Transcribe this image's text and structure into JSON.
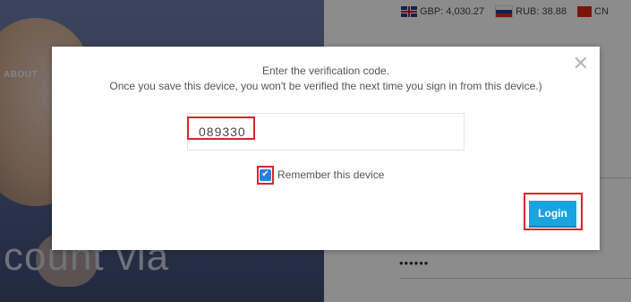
{
  "background": {
    "nav_about": "ABOUT",
    "hero_text": "count via",
    "password_mask": "••••••",
    "ticker": [
      {
        "flag": "uk-flag-icon",
        "label": "GBP: 4,030.27"
      },
      {
        "flag": "ru-flag-icon",
        "label": "RUB: 38.88"
      },
      {
        "flag": "cn-flag-icon",
        "label": "CN"
      }
    ]
  },
  "modal": {
    "title": "Enter the verification code.",
    "subtitle": "Once you save this device, you won't be verified the next time you sign in from this device.)",
    "close_icon": "close-icon",
    "code_value": "089330",
    "remember_label": "Remember this device",
    "remember_checked": true,
    "login_label": "Login"
  },
  "colors": {
    "accent": "#19a3df",
    "highlight": "#d9252b",
    "checkbox": "#2a7de1"
  }
}
